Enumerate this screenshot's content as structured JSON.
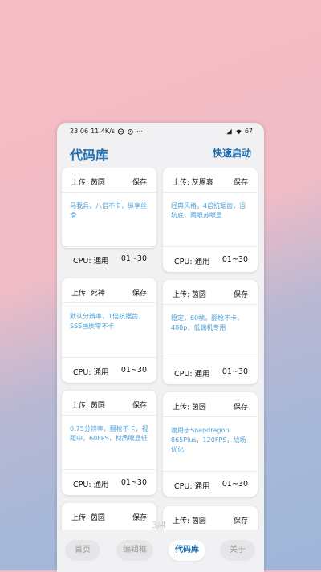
{
  "status_bar": {
    "time": "23:06",
    "net_speed": "11.4K/s",
    "battery": "67"
  },
  "header": {
    "title": "代码库",
    "quick_start": "快速启动"
  },
  "cards": [
    {
      "uploader": "上传: 茵圆",
      "save": "保存",
      "desc": "马我兵，八倍不卡，纵享丝滑",
      "cpu": "CPU: 通用",
      "range": "01~30"
    },
    {
      "uploader": "上传: 灰原哀",
      "save": "保存",
      "desc": "经典风格，4倍抗锯齿，运坑底，两眼苏眼显",
      "cpu": "CPU: 通用",
      "range": "01~30"
    },
    {
      "uploader": "上传: 死神",
      "save": "保存",
      "desc": "默认分辨率，1倍抗锯齿，SSS画质零不卡",
      "cpu": "CPU: 通用",
      "range": "01~30"
    },
    {
      "uploader": "上传: 茵圆",
      "save": "保存",
      "desc": "稳定，60帧，翻枪不卡，480p，低端机专用",
      "cpu": "CPU: 通用",
      "range": "01~30"
    },
    {
      "uploader": "上传: 茵圆",
      "save": "保存",
      "desc": "0.75分辨率，翻枪不卡，视距中，60FPS，材质眼显低",
      "cpu": "CPU: 通用",
      "range": "01~30"
    },
    {
      "uploader": "上传: 茵圆",
      "save": "保存",
      "desc": "適用于Snapdragon 865Plus，120FPS，战场优化",
      "cpu": "CPU: 通用",
      "range": "01~30"
    },
    {
      "uploader": "上传: 茵圆",
      "save": "保存"
    },
    {
      "uploader": "上传: 茵圆",
      "save": "保存"
    }
  ],
  "page_indicator": "3/4",
  "nav": {
    "home": "首页",
    "editor": "编辑框",
    "library": "代码库",
    "about": "关于"
  }
}
